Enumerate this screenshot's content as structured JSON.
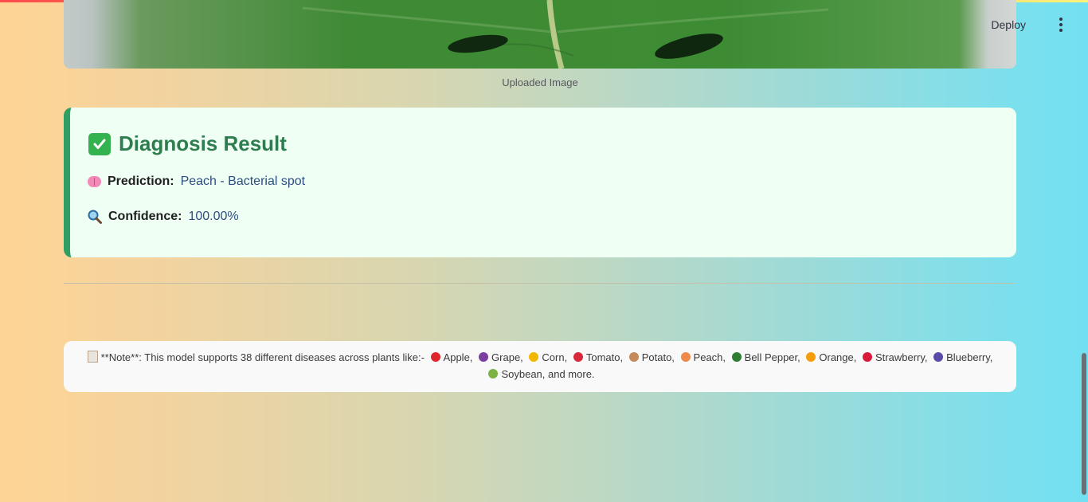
{
  "header": {
    "deploy_label": "Deploy",
    "menu_icon": "more-vertical-icon"
  },
  "uploaded_image": {
    "caption": "Uploaded Image"
  },
  "result": {
    "title": "Diagnosis Result",
    "title_icon": "check-mark-icon",
    "prediction_label": "Prediction:",
    "prediction_value": "Peach - Bacterial spot",
    "prediction_icon": "brain-icon",
    "confidence_label": "Confidence:",
    "confidence_value": "100.00%",
    "confidence_icon": "magnifying-glass-icon"
  },
  "note": {
    "prefix": "**Note**: This model supports 38 different diseases across plants like:-",
    "plants": [
      {
        "name": "Apple,",
        "icon": "apple-icon",
        "color": "#e0262d"
      },
      {
        "name": "Grape,",
        "icon": "grape-icon",
        "color": "#7a3fa1"
      },
      {
        "name": "Corn,",
        "icon": "corn-icon",
        "color": "#f2b705"
      },
      {
        "name": "Tomato,",
        "icon": "tomato-icon",
        "color": "#d8283b"
      },
      {
        "name": "Potato,",
        "icon": "potato-icon",
        "color": "#c48a5c"
      },
      {
        "name": "Peach,",
        "icon": "peach-icon",
        "color": "#f08a4b"
      },
      {
        "name": "Bell Pepper,",
        "icon": "bell-pepper-icon",
        "color": "#2e7d32"
      },
      {
        "name": "Orange,",
        "icon": "orange-icon",
        "color": "#f59e0b"
      },
      {
        "name": "Strawberry,",
        "icon": "strawberry-icon",
        "color": "#d81b3b"
      },
      {
        "name": "Blueberry,",
        "icon": "blueberry-icon",
        "color": "#5b4aa8"
      },
      {
        "name": "Soybean, and more.",
        "icon": "soybean-icon",
        "color": "#7cb342"
      }
    ]
  },
  "colors": {
    "accent_green": "#2e9e62",
    "value_blue": "#2d4e80"
  }
}
